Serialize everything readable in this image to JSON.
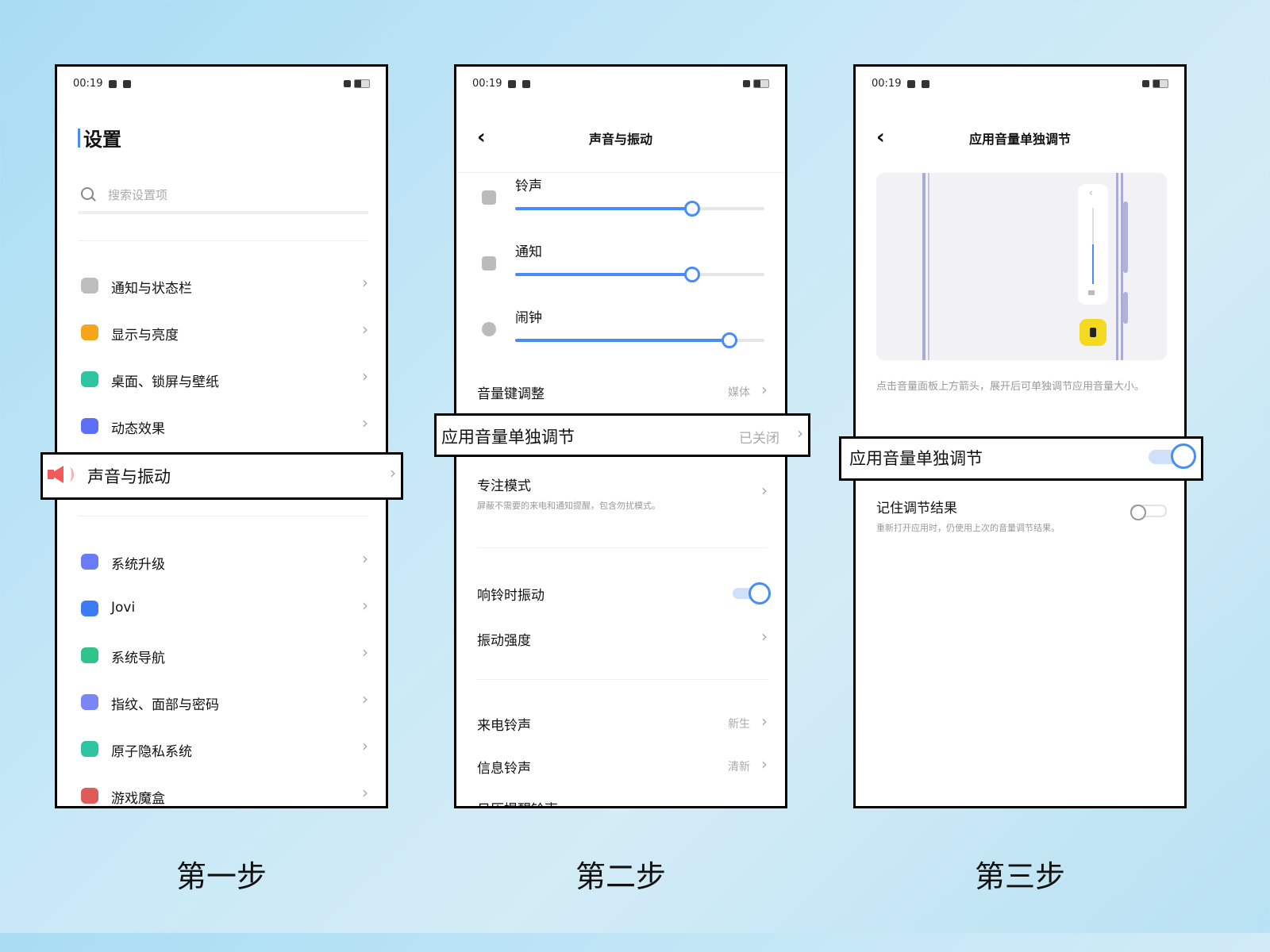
{
  "status": {
    "time": "00:19"
  },
  "phone1": {
    "title": "设置",
    "search_placeholder": "搜索设置项",
    "items_top": [
      {
        "label": "通知与状态栏",
        "icon": "notification-icon",
        "color": "#bdbdbd"
      },
      {
        "label": "显示与亮度",
        "icon": "display-icon",
        "color": "#f7a41d"
      },
      {
        "label": "桌面、锁屏与壁纸",
        "icon": "wallpaper-icon",
        "color": "#2ec4a0"
      },
      {
        "label": "动态效果",
        "icon": "animation-icon",
        "color": "#5b6ef5"
      }
    ],
    "highlight_item": {
      "label": "声音与振动",
      "icon": "sound-icon",
      "color": "#f05a5a"
    },
    "items_bottom": [
      {
        "label": "系统升级",
        "icon": "upgrade-icon",
        "color": "#6a7cf5"
      },
      {
        "label": "Jovi",
        "icon": "jovi-icon",
        "color": "#3d7bf5"
      },
      {
        "label": "系统导航",
        "icon": "navigation-icon",
        "color": "#2ec48a"
      },
      {
        "label": "指纹、面部与密码",
        "icon": "fingerprint-icon",
        "color": "#7a86f5"
      },
      {
        "label": "原子隐私系统",
        "icon": "privacy-icon",
        "color": "#2ec4a0"
      },
      {
        "label": "游戏魔盒",
        "icon": "game-icon",
        "color": "#e05a5a"
      }
    ]
  },
  "phone2": {
    "title": "声音与振动",
    "sliders": [
      {
        "label": "铃声",
        "value": 0.71,
        "icon": "bell-icon"
      },
      {
        "label": "通知",
        "value": 0.71,
        "icon": "notification-icon"
      },
      {
        "label": "闹钟",
        "value": 0.86,
        "icon": "alarm-icon"
      }
    ],
    "volume_key": {
      "label": "音量键调整",
      "value": "媒体"
    },
    "highlight": {
      "label": "应用音量单独调节",
      "value": "已关闭"
    },
    "focus": {
      "label": "专注模式",
      "desc": "屏蔽不需要的来电和通知提醒，包含勿扰模式。"
    },
    "vibrate_ring": {
      "label": "响铃时振动",
      "on": true
    },
    "vibrate_strength": {
      "label": "振动强度"
    },
    "ringtone": {
      "label": "来电铃声",
      "value": "新生"
    },
    "msg_tone": {
      "label": "信息铃声",
      "value": "清新"
    },
    "cut_off": {
      "label": "日历提醒铃声"
    }
  },
  "phone3": {
    "title": "应用音量单独调节",
    "hint": "点击音量面板上方箭头，展开后可单独调节应用音量大小。",
    "highlight": {
      "label": "应用音量单独调节",
      "on": true
    },
    "remember": {
      "label": "记住调节结果",
      "desc": "重新打开应用时，仍使用上次的音量调节结果。",
      "on": false
    }
  },
  "steps": [
    "第一步",
    "第二步",
    "第三步"
  ],
  "colors": {
    "accent": "#4a8cf7",
    "toggle_on_track": "#cfe0fb"
  }
}
